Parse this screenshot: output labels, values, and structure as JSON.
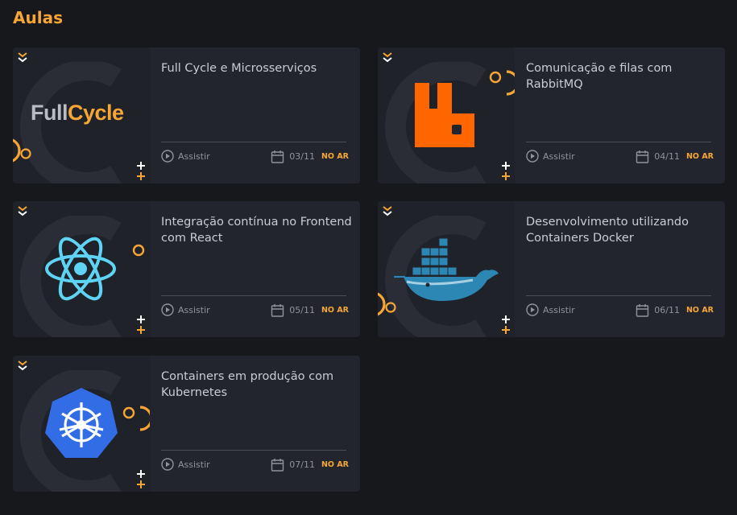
{
  "page": {
    "title": "Aulas"
  },
  "colors": {
    "accent": "#f7a636",
    "card_bg": "#22252d",
    "page_bg": "#17181c"
  },
  "lessons": [
    {
      "title": "Full Cycle e Microsserviços",
      "watch_label": "Assistir",
      "date": "03/11",
      "status": "NO AR",
      "logo": "fullcycle-logo",
      "logo_text_a": "Full",
      "logo_text_b": "Cycle"
    },
    {
      "title": "Comunicação e filas com RabbitMQ",
      "watch_label": "Assistir",
      "date": "04/11",
      "status": "NO AR",
      "logo": "rabbitmq-logo"
    },
    {
      "title": "Integração contínua no Frontend com React",
      "watch_label": "Assistir",
      "date": "05/11",
      "status": "NO AR",
      "logo": "react-logo"
    },
    {
      "title": "Desenvolvimento utilizando Containers Docker",
      "watch_label": "Assistir",
      "date": "06/11",
      "status": "NO AR",
      "logo": "docker-logo"
    },
    {
      "title": "Containers em produção com Kubernetes",
      "watch_label": "Assistir",
      "date": "07/11",
      "status": "NO AR",
      "logo": "kubernetes-logo"
    }
  ]
}
